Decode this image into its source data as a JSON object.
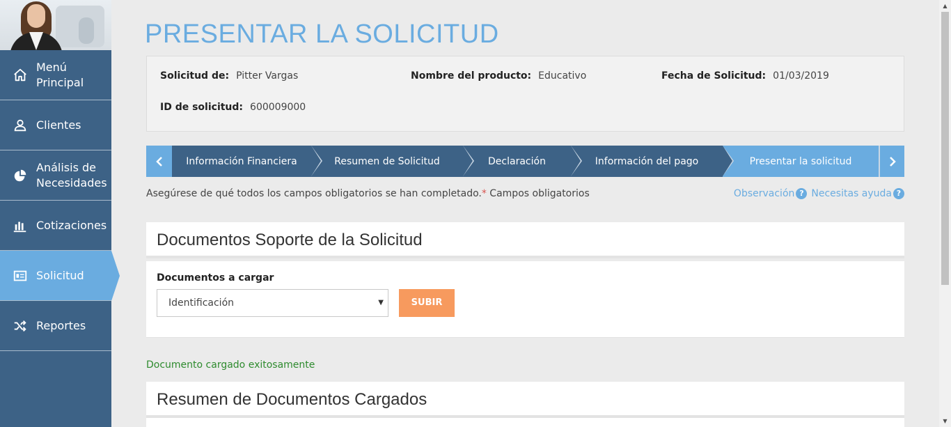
{
  "sidebar": {
    "items": [
      {
        "label": "Menú Principal",
        "icon": "home-icon"
      },
      {
        "label": "Clientes",
        "icon": "user-icon"
      },
      {
        "label": "Análisis de Necesidades",
        "icon": "pie-chart-icon"
      },
      {
        "label": "Cotizaciones",
        "icon": "bar-chart-icon"
      },
      {
        "label": "Solicitud",
        "icon": "document-icon",
        "active": true
      },
      {
        "label": "Reportes",
        "icon": "shuffle-icon"
      }
    ]
  },
  "page": {
    "title": "PRESENTAR LA SOLICITUD"
  },
  "info": {
    "solicitud_de_label": "Solicitud de:",
    "solicitud_de_value": "Pitter Vargas",
    "producto_label": "Nombre del producto:",
    "producto_value": "Educativo",
    "fecha_label": "Fecha de Solicitud:",
    "fecha_value": "01/03/2019",
    "id_label": "ID de solicitud:",
    "id_value": "600009000"
  },
  "stepper": {
    "prev_icon": "chevron-left-icon",
    "next_icon": "chevron-right-icon",
    "steps": [
      "Información Financiera",
      "Resumen de Solicitud",
      "Declaración",
      "Información del pago",
      "Presentar la solicitud"
    ],
    "active_index": 4
  },
  "hint": {
    "text": "Asegúrese de qué todos los campos obligatorios se han completado.",
    "asterisk": "*",
    "required_text": " Campos obligatorios"
  },
  "links": {
    "observacion": "Observación",
    "ayuda": "Necesitas ayuda",
    "help_icon": "?"
  },
  "documents": {
    "title": "Documentos Soporte de la Solicitud",
    "label": "Documentos a cargar",
    "selected": "Identificación",
    "upload_button": "SUBIR"
  },
  "status": {
    "success": "Documento cargado exitosamente"
  },
  "summary": {
    "title": "Resumen de Documentos Cargados"
  },
  "colors": {
    "sidebar": "#3d6286",
    "accent": "#6aace0",
    "upload_button": "#f79a5e",
    "success": "#2e8b2e"
  }
}
